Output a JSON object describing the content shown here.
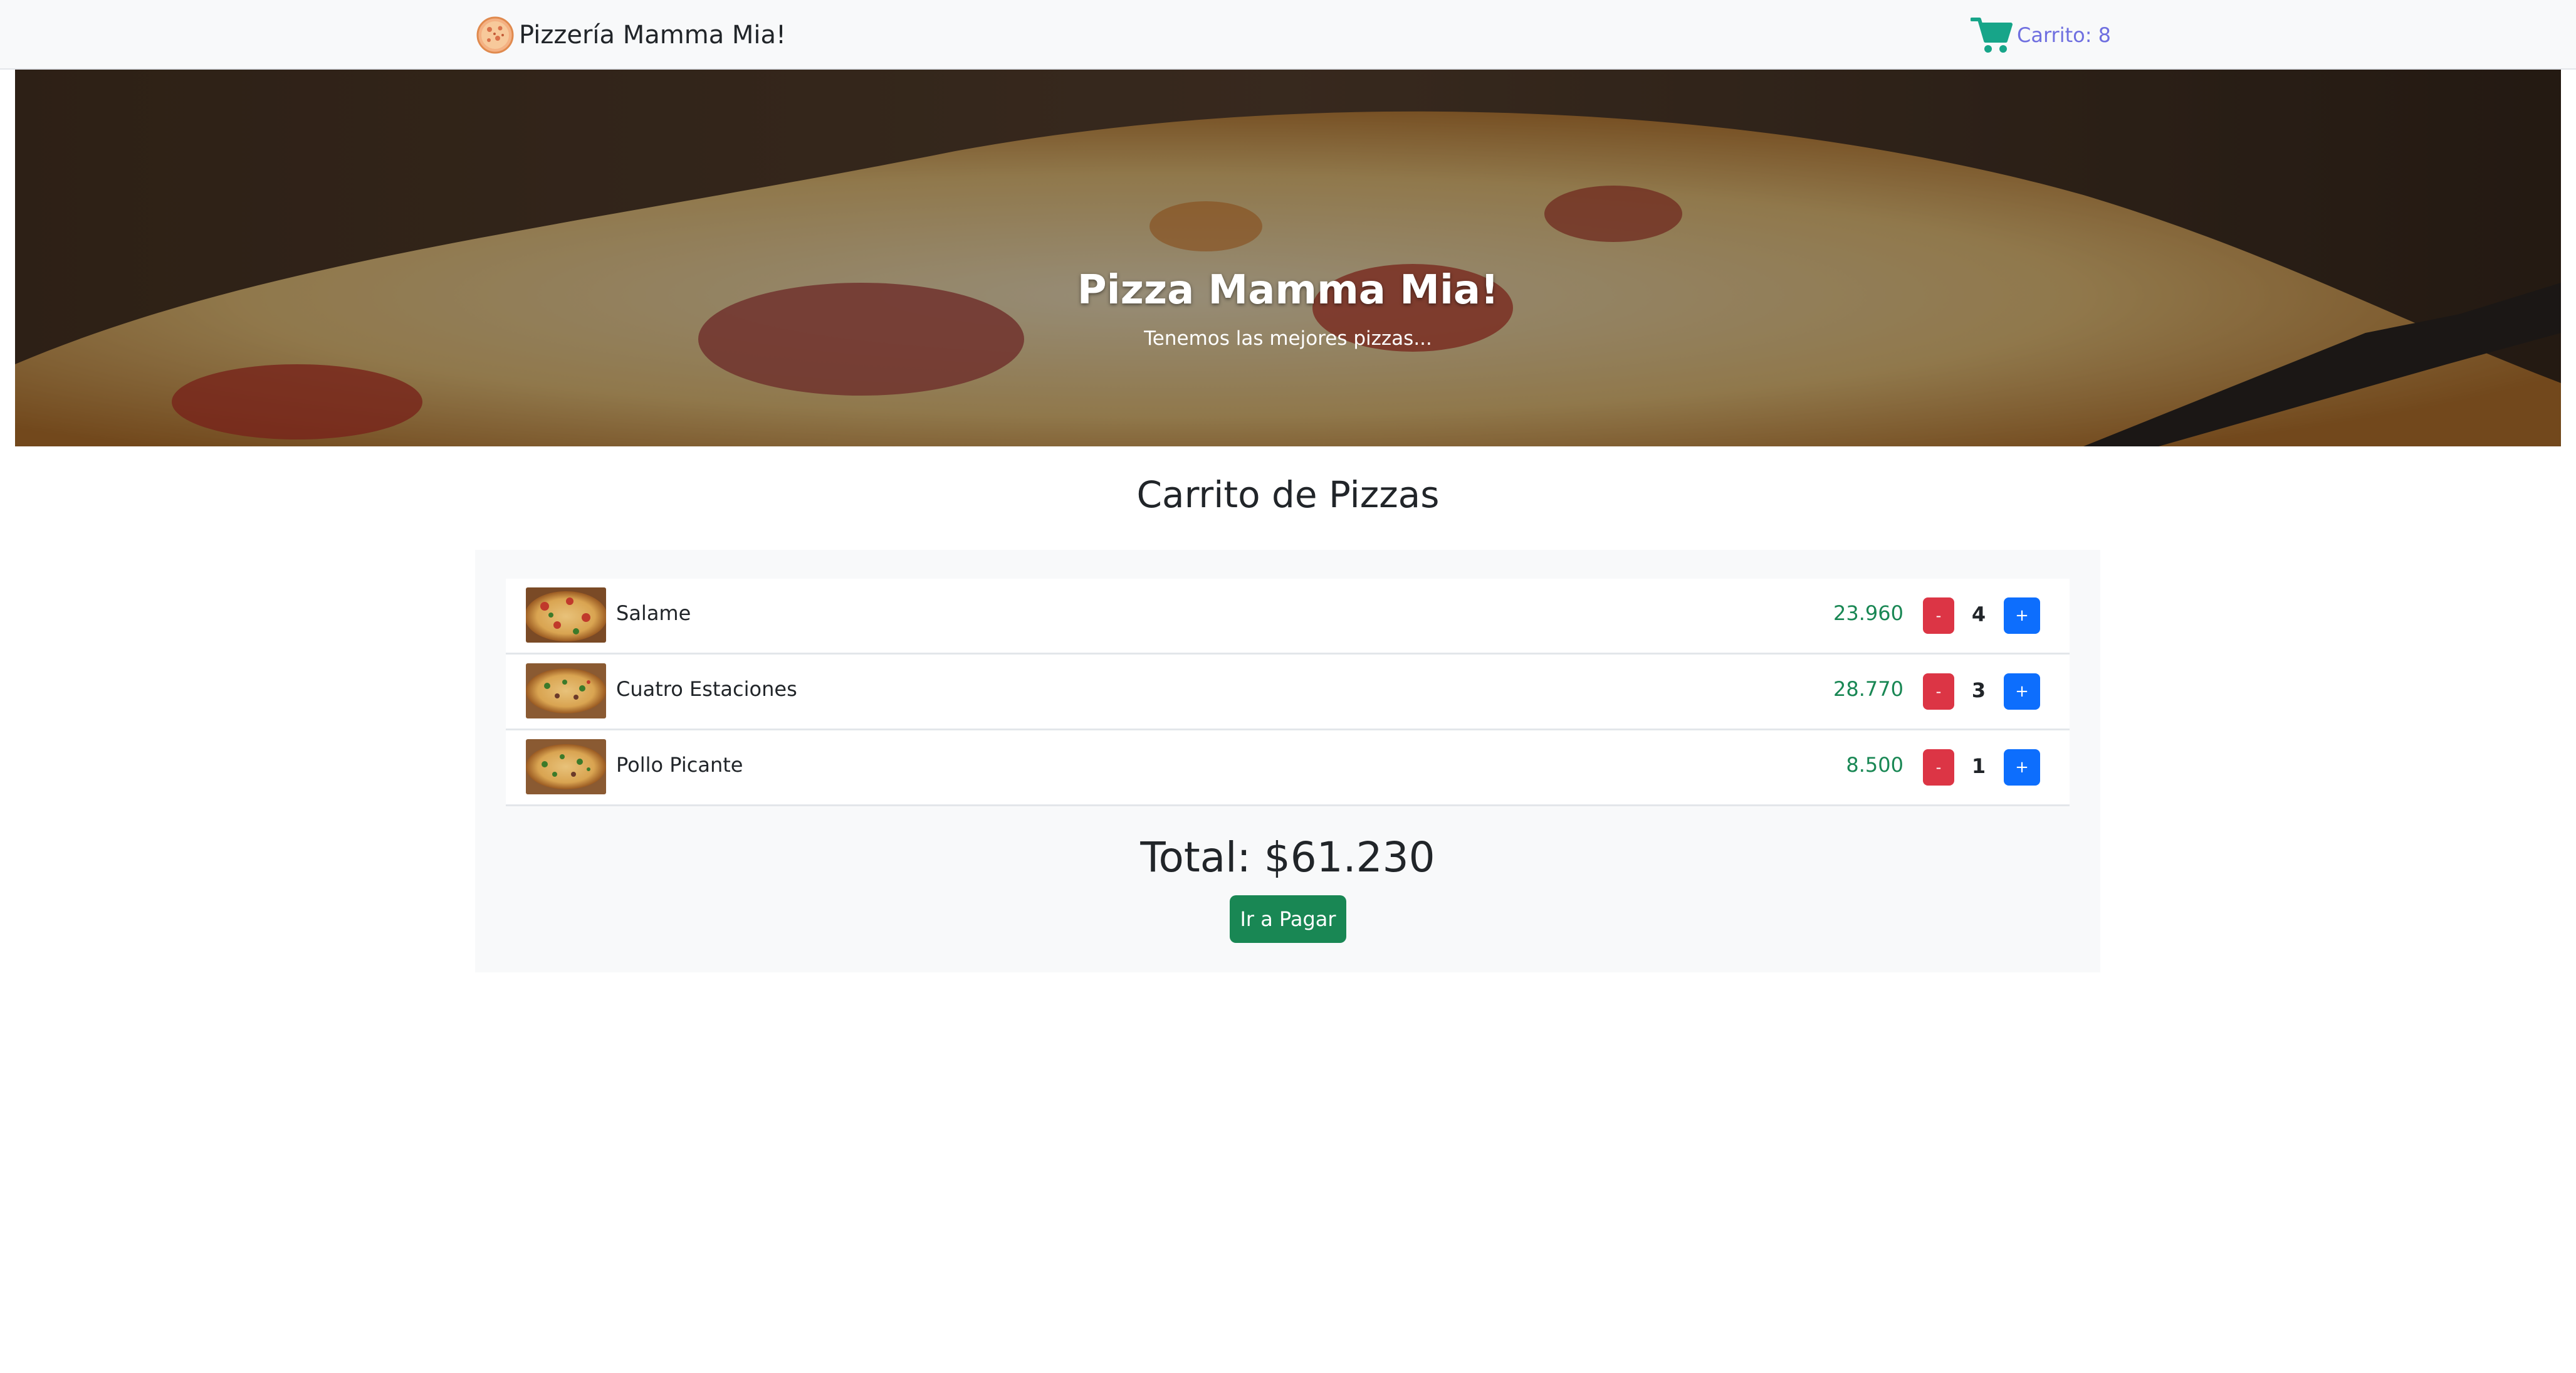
{
  "navbar": {
    "brand_icon": "pizza-icon",
    "brand_text": "Pizzería Mamma Mia!",
    "cart_icon": "shopping-cart-icon",
    "cart_text": "Carrito: 8"
  },
  "hero": {
    "title": "Pizza Mamma Mia!",
    "subtitle": "Tenemos las mejores pizzas..."
  },
  "cart": {
    "heading": "Carrito de Pizzas",
    "items": [
      {
        "name": "Salame",
        "price": "23.960",
        "quantity": "4",
        "minus_label": "-",
        "plus_label": "+"
      },
      {
        "name": "Cuatro Estaciones",
        "price": "28.770",
        "quantity": "3",
        "minus_label": "-",
        "plus_label": "+"
      },
      {
        "name": "Pollo Picante",
        "price": "8.500",
        "quantity": "1",
        "minus_label": "-",
        "plus_label": "+"
      }
    ],
    "total": "Total: $61.230",
    "pay_label": "Ir a Pagar"
  },
  "colors": {
    "navbar_bg": "#f8f9fa",
    "cart_text": "#6f6fe0",
    "cart_icon": "#17a589",
    "price": "#198754",
    "minus_button": "#dc3545",
    "plus_button": "#0d6efd",
    "pay_button": "#198754"
  }
}
